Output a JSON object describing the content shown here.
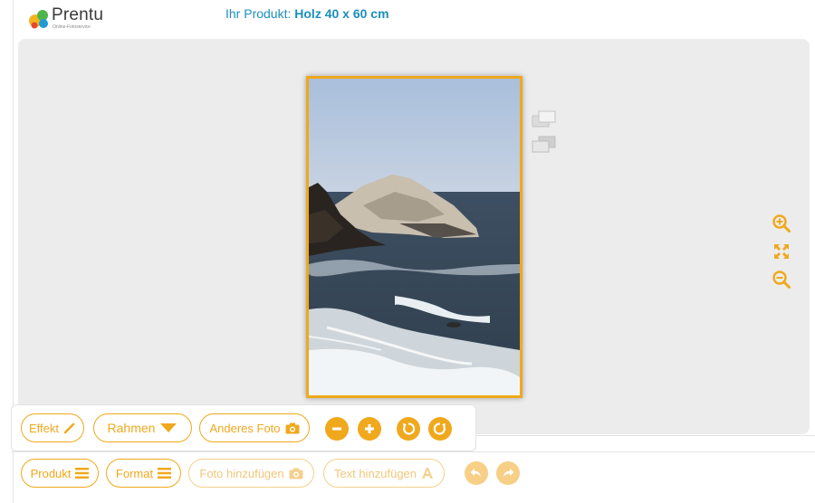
{
  "brand": {
    "name": "Prentu",
    "tagline": "Online-Fotoservice"
  },
  "product": {
    "label": "Ihr Produkt:",
    "value": "Holz 40 x 60 cm"
  },
  "toolbar_primary": {
    "effekt": "Effekt",
    "rahmen": "Rahmen",
    "anderes_foto": "Anderes Foto"
  },
  "toolbar_secondary": {
    "produkt": "Produkt",
    "format": "Format",
    "foto_hinzufuegen": "Foto hinzufügen",
    "text_hinzufuegen": "Text hinzufügen"
  },
  "icons": {
    "accent": "#f0a81c",
    "accent_light": "#f7cf86",
    "product_text": "#1c8fbd"
  }
}
